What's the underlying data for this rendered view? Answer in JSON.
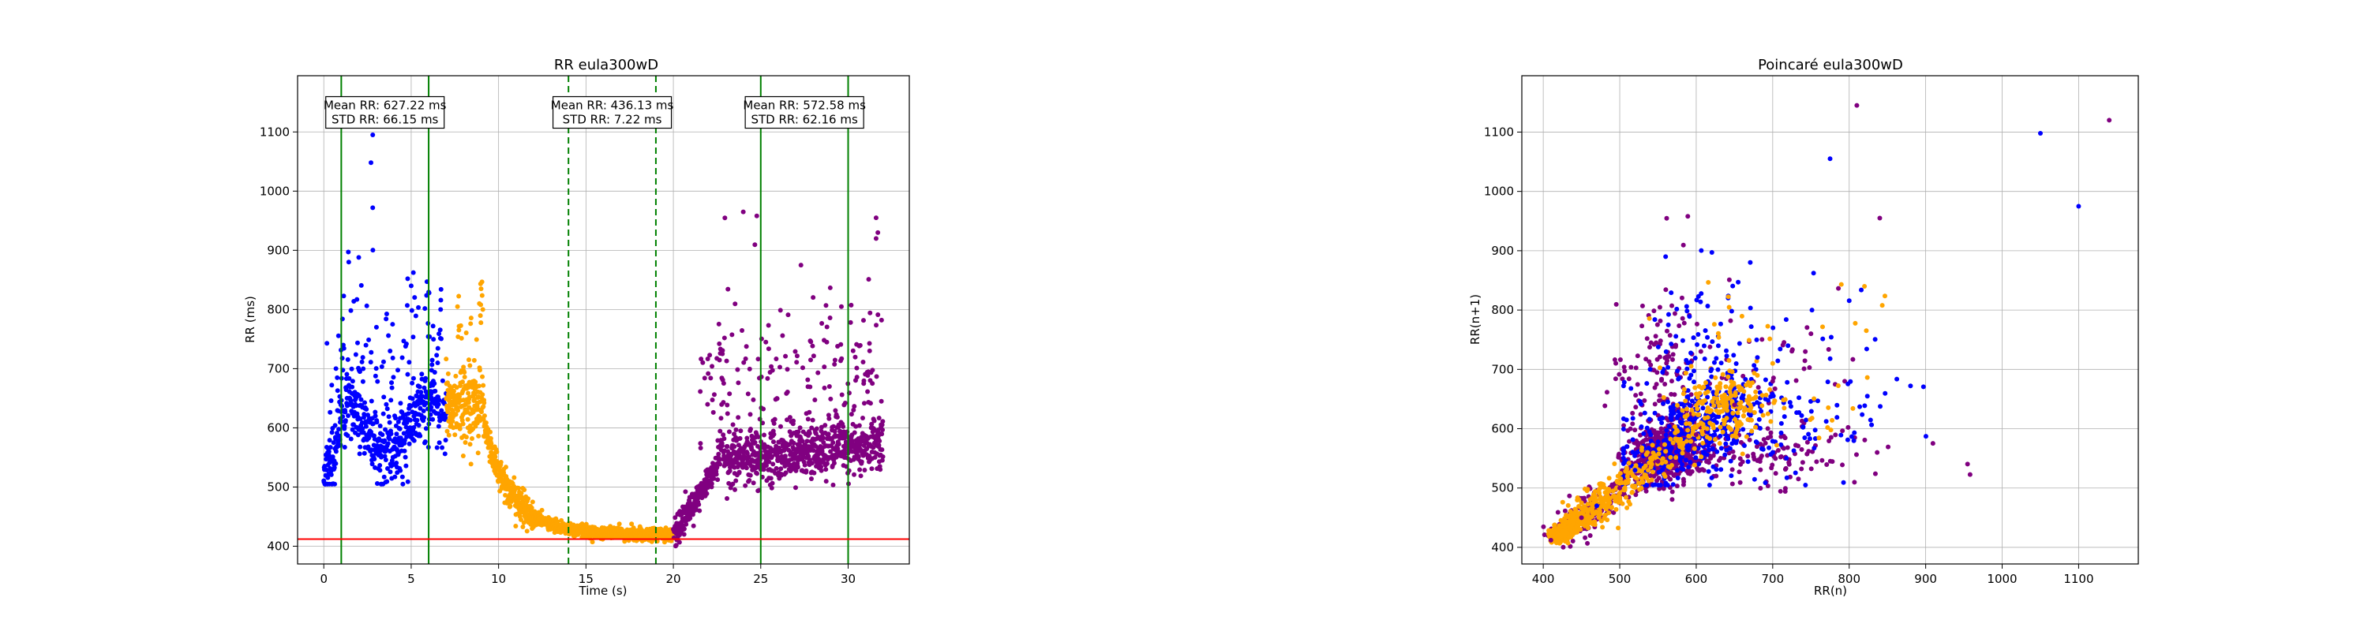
{
  "chart_data": [
    {
      "type": "scatter",
      "title": "RR eula300wD",
      "xlabel": "Time (s)",
      "ylabel": "RR (ms)",
      "xlim": [
        -1.5,
        33.5
      ],
      "ylim": [
        370,
        1195
      ],
      "xticks": [
        0,
        5,
        10,
        15,
        20,
        25,
        30
      ],
      "yticks": [
        400,
        500,
        600,
        700,
        800,
        900,
        1000,
        1100
      ],
      "grid": true,
      "colors": {
        "blue": "#0000ff",
        "orange": "#ffa500",
        "purple": "#800080",
        "green": "#008000",
        "red": "#ff0000"
      },
      "series": [
        {
          "color": "blue",
          "x_range": [
            0,
            7
          ],
          "description_values": {
            "mean": 627.22,
            "std": 66.15
          },
          "x": [
            0.0,
            0.5,
            1.0,
            1.5,
            2.0,
            2.5,
            2.8,
            3.0,
            3.5,
            4.0,
            4.5,
            5.0,
            5.5,
            6.0,
            6.5,
            7.0
          ],
          "y": [
            520,
            560,
            600,
            640,
            680,
            620,
            1095,
            610,
            650,
            620,
            600,
            700,
            760,
            620,
            610,
            650
          ]
        },
        {
          "color": "orange",
          "x_range": [
            7,
            20
          ],
          "description_values": {
            "mean": 436.13,
            "std": 7.22
          },
          "x": [
            7.0,
            8.0,
            9.0,
            10.0,
            11.0,
            12.0,
            13.0,
            14.0,
            15.0,
            16.0,
            17.0,
            18.0,
            19.0,
            20.0
          ],
          "y": [
            650,
            630,
            640,
            540,
            500,
            475,
            460,
            450,
            445,
            440,
            435,
            430,
            425,
            420
          ]
        },
        {
          "color": "purple",
          "x_range": [
            20,
            32
          ],
          "description_values": {
            "mean": 572.58,
            "std": 62.16
          },
          "x": [
            20.0,
            21.0,
            22.0,
            23.0,
            24.0,
            25.0,
            26.0,
            27.0,
            28.0,
            29.0,
            30.0,
            31.0,
            32.0
          ],
          "y": [
            420,
            480,
            520,
            540,
            560,
            550,
            560,
            570,
            560,
            570,
            580,
            600,
            620
          ]
        }
      ],
      "vlines": [
        {
          "x": 1.0,
          "style": "solid",
          "color": "green"
        },
        {
          "x": 6.0,
          "style": "solid",
          "color": "green"
        },
        {
          "x": 14.0,
          "style": "dashed",
          "color": "green"
        },
        {
          "x": 19.0,
          "style": "dashed",
          "color": "green"
        },
        {
          "x": 25.0,
          "style": "solid",
          "color": "green"
        },
        {
          "x": 30.0,
          "style": "solid",
          "color": "green"
        }
      ],
      "hline": {
        "y": 412,
        "color": "red"
      },
      "annotations": [
        {
          "x": 3.5,
          "y": 1133,
          "line1": "Mean RR: 627.22 ms",
          "line2": "STD RR: 66.15 ms"
        },
        {
          "x": 16.5,
          "y": 1133,
          "line1": "Mean RR: 436.13 ms",
          "line2": "STD RR: 7.22 ms"
        },
        {
          "x": 27.5,
          "y": 1133,
          "line1": "Mean RR: 572.58 ms",
          "line2": "STD RR: 62.16 ms"
        }
      ]
    },
    {
      "type": "scatter",
      "title": "Poincaré eula300wD",
      "xlabel": "RR(n)",
      "ylabel": "RR(n+1)",
      "xlim": [
        372,
        1178
      ],
      "ylim": [
        372,
        1195
      ],
      "xticks": [
        400,
        500,
        600,
        700,
        800,
        900,
        1000,
        1100
      ],
      "yticks": [
        400,
        500,
        600,
        700,
        800,
        900,
        1000,
        1100
      ],
      "grid": true,
      "series": [
        {
          "color": "orange",
          "x": [
            420,
            450,
            480,
            520,
            560,
            600,
            640,
            680,
            700,
            820
          ],
          "y": [
            420,
            448,
            482,
            518,
            562,
            602,
            640,
            690,
            710,
            840
          ]
        },
        {
          "color": "purple",
          "x": [
            410,
            450,
            500,
            550,
            600,
            650,
            700,
            750,
            810,
            840,
            1140
          ],
          "y": [
            412,
            450,
            500,
            545,
            590,
            640,
            680,
            760,
            1145,
            955,
            1120
          ]
        },
        {
          "color": "blue",
          "x": [
            470,
            520,
            560,
            620,
            680,
            720,
            775,
            1050,
            1100
          ],
          "y": [
            470,
            530,
            890,
            700,
            720,
            740,
            1055,
            1098,
            975
          ]
        }
      ]
    }
  ]
}
